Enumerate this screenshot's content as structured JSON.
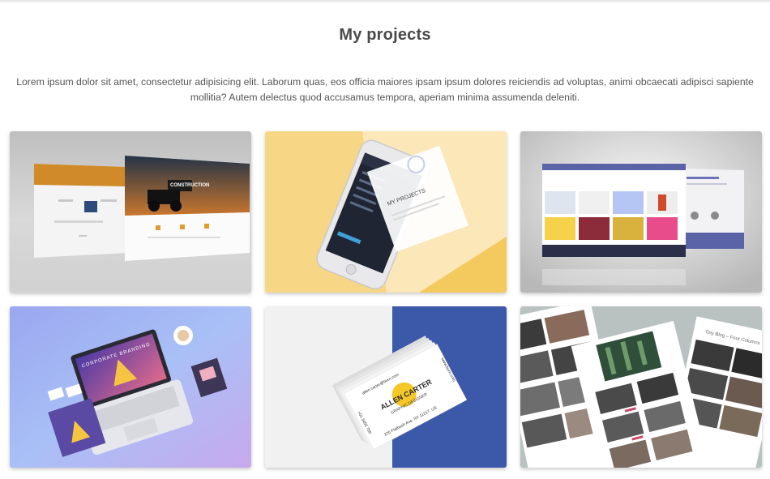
{
  "section": {
    "title": "My projects",
    "intro": "Lorem ipsum dolor sit amet, consectetur adipisicing elit. Laborum quas, eos officia maiores ipsam ipsum dolores reiciendis ad voluptas, animi obcaecati adipisci sapiente mollitia? Autem delectus quod accusamus tempora, aperiam minima assumenda deleniti."
  },
  "projects": [
    {
      "name": "construction-website-mockup",
      "screen_text": "CONSTRUCTION"
    },
    {
      "name": "mobile-app-mockup",
      "screen_text": "MY PROJECTS"
    },
    {
      "name": "ecommerce-website-mockup"
    },
    {
      "name": "laptop-branding-mockup",
      "screen_text": "CORPORATE BRANDING"
    },
    {
      "name": "business-card-mockup",
      "card_name": "ALLEN CARTER",
      "card_role": "GRAPHIC DESIGNER",
      "card_email": "allen.carter@burn.com",
      "card_address": "225 Flatbush Ave, NY 11217, US",
      "card_phone": "+01 3456 789",
      "card_web": "www.burn.com"
    },
    {
      "name": "blog-layout-mockup",
      "screen_text": "Tiny Blog – Four Columns"
    }
  ],
  "colors": {
    "heading": "#4a4a4a",
    "body_text": "#555555",
    "accent_yellow": "#f7c84a",
    "accent_blue": "#3b5aa8"
  }
}
